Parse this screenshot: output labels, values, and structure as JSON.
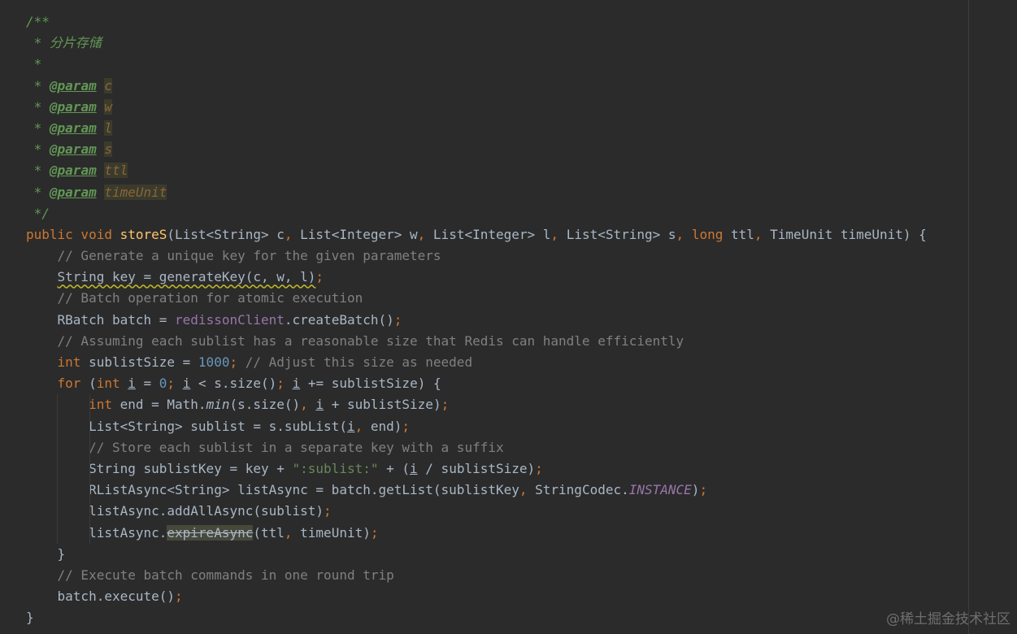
{
  "editor": {
    "lines": [
      {
        "kind": "doc",
        "text": "/**"
      },
      {
        "kind": "doc",
        "text": " * 分片存储"
      },
      {
        "kind": "doc",
        "text": " *"
      },
      {
        "kind": "param",
        "prefix": " * ",
        "tag": "@param",
        "name": "c"
      },
      {
        "kind": "param",
        "prefix": " * ",
        "tag": "@param",
        "name": "w"
      },
      {
        "kind": "param",
        "prefix": " * ",
        "tag": "@param",
        "name": "l"
      },
      {
        "kind": "param",
        "prefix": " * ",
        "tag": "@param",
        "name": "s"
      },
      {
        "kind": "param",
        "prefix": " * ",
        "tag": "@param",
        "name": "ttl"
      },
      {
        "kind": "param",
        "prefix": " * ",
        "tag": "@param",
        "name": "timeUnit"
      },
      {
        "kind": "doc",
        "text": " */"
      },
      {
        "kind": "code",
        "indent": 0,
        "parts": [
          [
            "kw",
            "public void "
          ],
          [
            "fn",
            "storeS"
          ],
          [
            "",
            "(List<String> c"
          ],
          [
            "kw",
            ", "
          ],
          [
            "",
            "List<Integer> w"
          ],
          [
            "kw",
            ", "
          ],
          [
            "",
            "List<Integer> l"
          ],
          [
            "kw",
            ", "
          ],
          [
            "",
            "List<String> s"
          ],
          [
            "kw",
            ", long "
          ],
          [
            "",
            "ttl"
          ],
          [
            "kw",
            ", "
          ],
          [
            "",
            "TimeUnit timeUnit) {"
          ]
        ]
      },
      {
        "kind": "code",
        "indent": 1,
        "parts": [
          [
            "cmt",
            "// Generate a unique key for the given parameters"
          ]
        ]
      },
      {
        "kind": "code",
        "indent": 1,
        "parts": [
          [
            "warn",
            "String key = generateKey(c, w, l)"
          ],
          [
            "kw",
            ";"
          ]
        ]
      },
      {
        "kind": "code",
        "indent": 1,
        "parts": [
          [
            "cmt",
            "// Batch operation for atomic execution"
          ]
        ]
      },
      {
        "kind": "code",
        "indent": 1,
        "parts": [
          [
            "",
            "RBatch batch = "
          ],
          [
            "fld",
            "redissonClient"
          ],
          [
            "",
            ".createBatch()"
          ],
          [
            "kw",
            ";"
          ]
        ]
      },
      {
        "kind": "code",
        "indent": 1,
        "parts": [
          [
            "cmt",
            "// Assuming each sublist has a reasonable size that Redis can handle efficiently"
          ]
        ]
      },
      {
        "kind": "code",
        "indent": 1,
        "parts": [
          [
            "kw",
            "int "
          ],
          [
            "",
            "sublistSize = "
          ],
          [
            "num",
            "1000"
          ],
          [
            "kw",
            "; "
          ],
          [
            "cmt",
            "// Adjust this size as needed"
          ]
        ]
      },
      {
        "kind": "code",
        "indent": 1,
        "parts": [
          [
            "kw",
            "for "
          ],
          [
            "",
            "("
          ],
          [
            "kw",
            "int "
          ],
          [
            "uline",
            "i"
          ],
          [
            "",
            " = "
          ],
          [
            "num",
            "0"
          ],
          [
            "kw",
            "; "
          ],
          [
            "uline",
            "i"
          ],
          [
            "",
            " < s.size()"
          ],
          [
            "kw",
            "; "
          ],
          [
            "uline",
            "i"
          ],
          [
            "",
            " += sublistSize) {"
          ]
        ]
      },
      {
        "kind": "code",
        "indent": 2,
        "parts": [
          [
            "kw",
            "int "
          ],
          [
            "",
            "end = Math."
          ],
          [
            "ital",
            "min"
          ],
          [
            "",
            "(s.size()"
          ],
          [
            "kw",
            ", "
          ],
          [
            "uline",
            "i"
          ],
          [
            "",
            " + sublistSize)"
          ],
          [
            "kw",
            ";"
          ]
        ]
      },
      {
        "kind": "code",
        "indent": 2,
        "parts": [
          [
            "",
            "List<String> sublist = s.subList("
          ],
          [
            "uline",
            "i"
          ],
          [
            "kw",
            ", "
          ],
          [
            "",
            "end)"
          ],
          [
            "kw",
            ";"
          ]
        ]
      },
      {
        "kind": "code",
        "indent": 2,
        "parts": [
          [
            "cmt",
            "// Store each sublist in a separate key with a suffix"
          ]
        ]
      },
      {
        "kind": "code",
        "indent": 2,
        "parts": [
          [
            "",
            "String sublistKey = key + "
          ],
          [
            "str",
            "\":sublist:\""
          ],
          [
            "",
            " + ("
          ],
          [
            "uline",
            "i"
          ],
          [
            "",
            " / sublistSize)"
          ],
          [
            "kw",
            ";"
          ]
        ]
      },
      {
        "kind": "code",
        "indent": 2,
        "parts": [
          [
            "",
            "RListAsync<String> listAsync = batch.getList(sublistKey"
          ],
          [
            "kw",
            ", "
          ],
          [
            "",
            "StringCodec."
          ],
          [
            "sfld",
            "INSTANCE"
          ],
          [
            "",
            ")"
          ],
          [
            "kw",
            ";"
          ]
        ]
      },
      {
        "kind": "code",
        "indent": 2,
        "parts": [
          [
            "",
            "listAsync.addAllAsync(sublist)"
          ],
          [
            "kw",
            ";"
          ]
        ]
      },
      {
        "kind": "code",
        "indent": 2,
        "parts": [
          [
            "",
            "listAsync."
          ],
          [
            "deprecated",
            "expireAsync"
          ],
          [
            "",
            "(ttl"
          ],
          [
            "kw",
            ", "
          ],
          [
            "",
            "timeUnit)"
          ],
          [
            "kw",
            ";"
          ]
        ]
      },
      {
        "kind": "code",
        "indent": 1,
        "parts": [
          [
            "",
            "}"
          ]
        ]
      },
      {
        "kind": "code",
        "indent": 1,
        "parts": [
          [
            "cmt",
            "// Execute batch commands in one round trip"
          ]
        ]
      },
      {
        "kind": "code",
        "indent": 1,
        "parts": [
          [
            "",
            "batch.execute()"
          ],
          [
            "kw",
            ";"
          ]
        ]
      },
      {
        "kind": "code",
        "indent": 0,
        "parts": [
          [
            "",
            "}"
          ]
        ]
      }
    ]
  },
  "watermark": {
    "text": "@稀土掘金技术社区"
  },
  "colors": {
    "background": "#2b2b2b",
    "keyword": "#cc7832",
    "function": "#ffc66d",
    "comment": "#808080",
    "doc": "#629755",
    "number": "#6897bb",
    "string": "#6a8759",
    "field": "#9876aa"
  }
}
